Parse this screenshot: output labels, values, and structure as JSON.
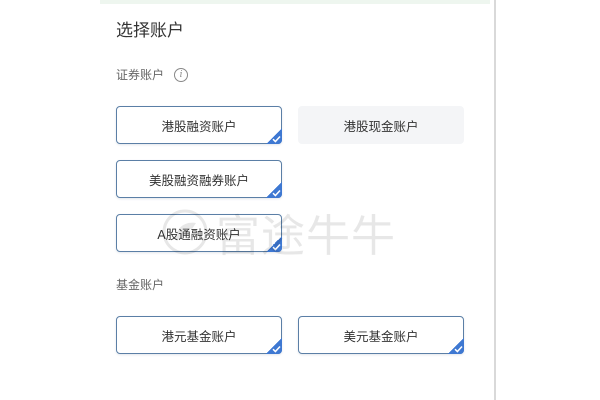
{
  "panel": {
    "title": "选择账户",
    "securities": {
      "label": "证券账户",
      "info_icon": "ⓘ",
      "accounts": [
        {
          "label": "港股融资账户",
          "selected": true
        },
        {
          "label": "港股现金账户",
          "selected": false
        },
        {
          "label": "美股融资融券账户",
          "selected": true
        },
        {
          "label": "A股通融资账户",
          "selected": true
        }
      ]
    },
    "funds": {
      "label": "基金账户",
      "accounts": [
        {
          "label": "港元基金账户",
          "selected": true
        },
        {
          "label": "美元基金账户",
          "selected": true
        }
      ]
    }
  },
  "watermark": {
    "text": "富途牛牛"
  },
  "colors": {
    "accent": "#3e78d2",
    "selected_border": "#5b7fa6",
    "unselected_bg": "#f4f5f7"
  },
  "icons": {
    "check": "check-icon",
    "info": "info-icon",
    "watermark_logo": "futu-logo-icon"
  }
}
